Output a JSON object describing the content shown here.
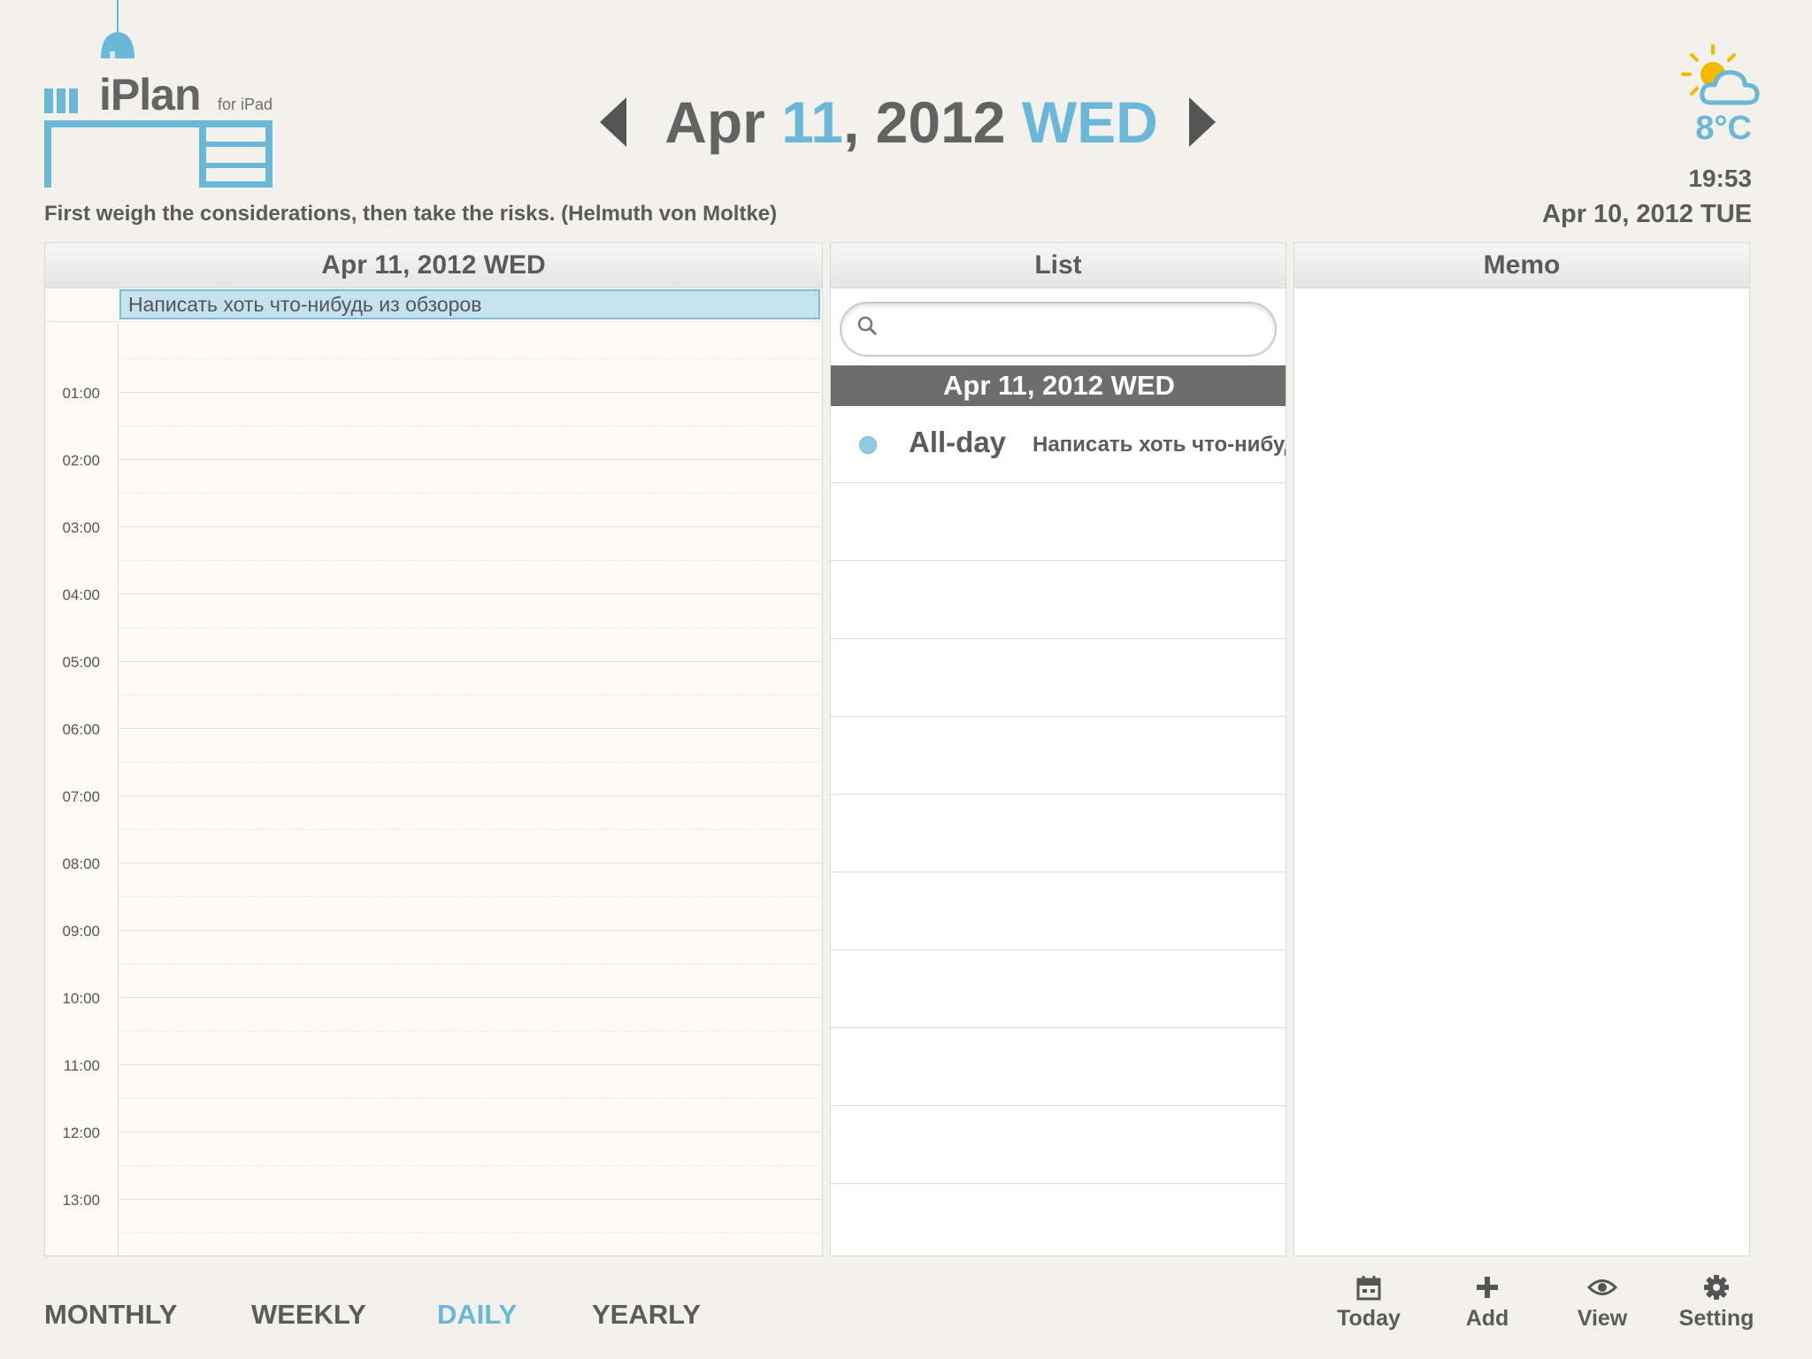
{
  "app": {
    "name": "iPlan",
    "subtitle": "for iPad"
  },
  "header": {
    "date_month": "Apr",
    "date_day": "11",
    "date_year": ", 2012",
    "date_weekday": "WED",
    "quote": "First weigh the considerations, then take the risks. (Helmuth von Moltke)"
  },
  "status": {
    "weather_icon": "partly-cloudy-icon",
    "temperature": "8°C",
    "time": "19:53",
    "today": "Apr 10, 2012 TUE"
  },
  "daily": {
    "header": "Apr 11, 2012 WED",
    "allday_event": "Написать хоть что-нибудь из обзоров",
    "hours": [
      "01:00",
      "02:00",
      "03:00",
      "04:00",
      "05:00",
      "06:00",
      "07:00",
      "08:00",
      "09:00",
      "10:00",
      "11:00",
      "12:00",
      "13:00"
    ]
  },
  "list": {
    "header": "List",
    "search_placeholder": "",
    "date_bar": "Apr 11, 2012 WED",
    "items": [
      {
        "time": "All-day",
        "title": "Написать хоть что-нибудь из обзоров",
        "color": "#8fcbe3"
      }
    ]
  },
  "memo": {
    "header": "Memo"
  },
  "views": {
    "monthly": "MONTHLY",
    "weekly": "WEEKLY",
    "daily": "DAILY",
    "yearly": "YEARLY",
    "active": "daily"
  },
  "tools": {
    "today": "Today",
    "add": "Add",
    "view": "View",
    "setting": "Setting"
  },
  "colors": {
    "accent": "#6ab7d7",
    "text": "#5b5b5b",
    "background": "#f3f1ec",
    "event_fill": "#c5e3ef"
  }
}
